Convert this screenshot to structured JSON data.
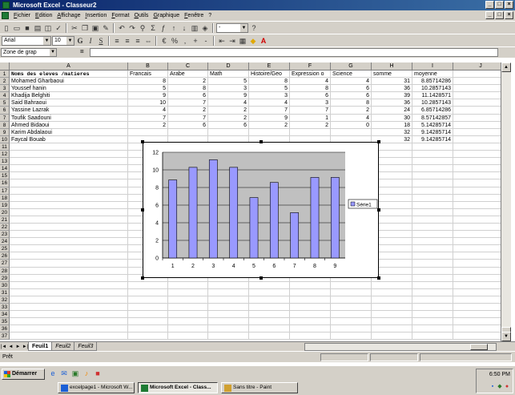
{
  "window": {
    "title": "Microsoft Excel - Classeur2",
    "controls": [
      "_",
      "□",
      "×"
    ],
    "doc_controls": [
      "_",
      "□",
      "×"
    ]
  },
  "menu": [
    "Fichier",
    "Edition",
    "Affichage",
    "Insertion",
    "Format",
    "Outils",
    "Graphique",
    "Fenêtre",
    "?"
  ],
  "toolbar": {
    "font_name": "Arial",
    "font_size": "10",
    "bold": "G",
    "italic": "I",
    "underline": "S",
    "zoom": "-"
  },
  "formula_bar": {
    "name_box": "Zone de grap",
    "equals": "="
  },
  "grid": {
    "columns": [
      "A",
      "B",
      "C",
      "D",
      "E",
      "F",
      "G",
      "H",
      "I",
      "J"
    ],
    "row_numbers": [
      "1",
      "2",
      "3",
      "4",
      "5",
      "6",
      "7",
      "8",
      "9",
      "10",
      "11",
      "12",
      "13",
      "14",
      "15",
      "16",
      "17",
      "18",
      "19",
      "20",
      "21",
      "22",
      "23",
      "24",
      "25",
      "26",
      "27",
      "28",
      "29",
      "30",
      "31",
      "32",
      "33",
      "34",
      "35",
      "36",
      "37"
    ],
    "header": [
      "Noms des eleves /matieres",
      "Francais",
      "Arabe",
      "Math",
      "Histoire/Geo",
      "Expression o",
      "Science",
      "somme",
      "moyenne"
    ],
    "rows": [
      [
        "Mohamed Gharbaoui",
        "8",
        "2",
        "5",
        "8",
        "4",
        "4",
        "31",
        "8.85714286"
      ],
      [
        "Youssef hanin",
        "5",
        "8",
        "3",
        "5",
        "8",
        "6",
        "36",
        "10.2857143"
      ],
      [
        "Khadija Belghiti",
        "9",
        "6",
        "9",
        "3",
        "6",
        "6",
        "39",
        "11.1428571"
      ],
      [
        "Said Bahraoui",
        "10",
        "7",
        "4",
        "4",
        "3",
        "8",
        "36",
        "10.2857143"
      ],
      [
        "Yassine Lazrak",
        "4",
        "2",
        "2",
        "7",
        "7",
        "2",
        "24",
        "6.85714286"
      ],
      [
        "Toufik Saadouni",
        "7",
        "7",
        "2",
        "9",
        "1",
        "4",
        "30",
        "8.57142857"
      ],
      [
        "Ahmed Bidaoui",
        "2",
        "6",
        "6",
        "2",
        "2",
        "0",
        "18",
        "5.14285714"
      ],
      [
        "Karim Abdalaoui",
        "",
        "",
        "",
        "",
        "",
        "",
        "32",
        "9.14285714"
      ],
      [
        "Faycal Bouab",
        "",
        "",
        "",
        "",
        "",
        "",
        "32",
        "9.14285714"
      ]
    ]
  },
  "chart_data": {
    "type": "bar",
    "categories": [
      "1",
      "2",
      "3",
      "4",
      "5",
      "6",
      "7",
      "8",
      "9"
    ],
    "series": [
      {
        "name": "Série1",
        "values": [
          8.857,
          10.286,
          11.143,
          10.286,
          6.857,
          8.571,
          5.143,
          9.143,
          9.143
        ],
        "color": "#9999ff"
      }
    ],
    "yticks": [
      "0",
      "2",
      "4",
      "6",
      "8",
      "10",
      "12"
    ],
    "ylim": [
      0,
      12
    ],
    "grid": true,
    "legend": "right",
    "plot_bg": "#c0c0c0"
  },
  "sheets": [
    "Feuil1",
    "Feuil2",
    "Feuil3"
  ],
  "status": "Prêt",
  "taskbar": {
    "start": "Démarrer",
    "quicklaunch_icons": [
      "ie-icon",
      "outlook-icon",
      "desktop-icon",
      "media-icon",
      "paint-icon"
    ],
    "tasks": [
      "excelpage1 - Microsoft W...",
      "Microsoft Excel - Class...",
      "Sans titre - Paint"
    ],
    "clock": "6:50 PM"
  }
}
